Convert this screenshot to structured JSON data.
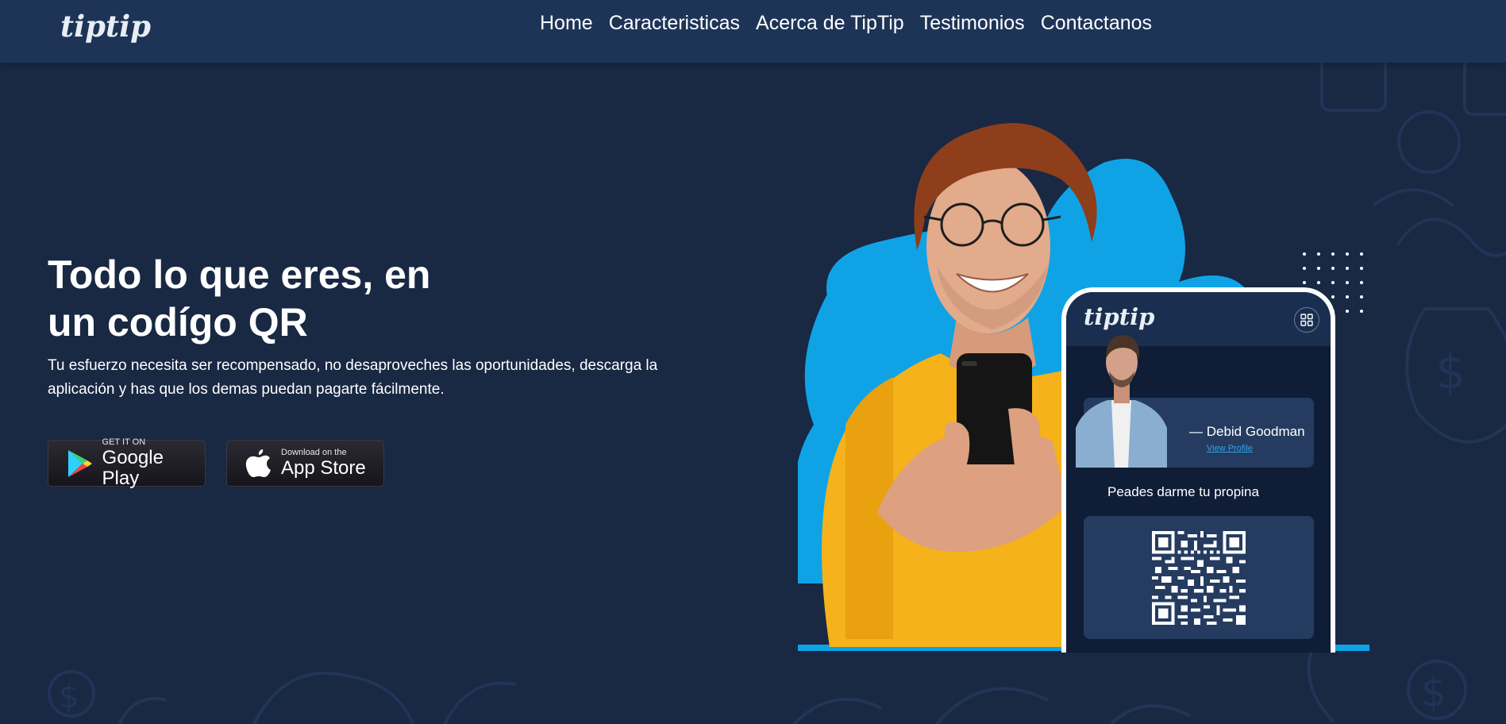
{
  "nav": {
    "logo": "tiptip",
    "links": [
      "Home",
      "Caracteristicas",
      "Acerca de TipTip",
      "Testimonios",
      "Contactanos"
    ]
  },
  "hero": {
    "title_line1": "Todo lo que eres, en",
    "title_line2": "un codígo QR",
    "subtitle": "Tu esfuerzo necesita ser recompensado, no desaproveches las oportunidades, descarga la aplicación y has que los demas puedan pagarte fácilmente."
  },
  "stores": {
    "google_small": "GET IT ON",
    "google_big": "Google Play",
    "apple_small": "Download on the",
    "apple_big": "App Store"
  },
  "phone": {
    "logo": "tiptip",
    "profile_name": "— Debid Goodman",
    "profile_link": "View Profile",
    "tip_text": "Peades darme tu propina"
  },
  "colors": {
    "background": "#192843",
    "navbar": "#1d3457",
    "accent_blue": "#0fa3e6",
    "shirt_yellow": "#f5b21a"
  }
}
